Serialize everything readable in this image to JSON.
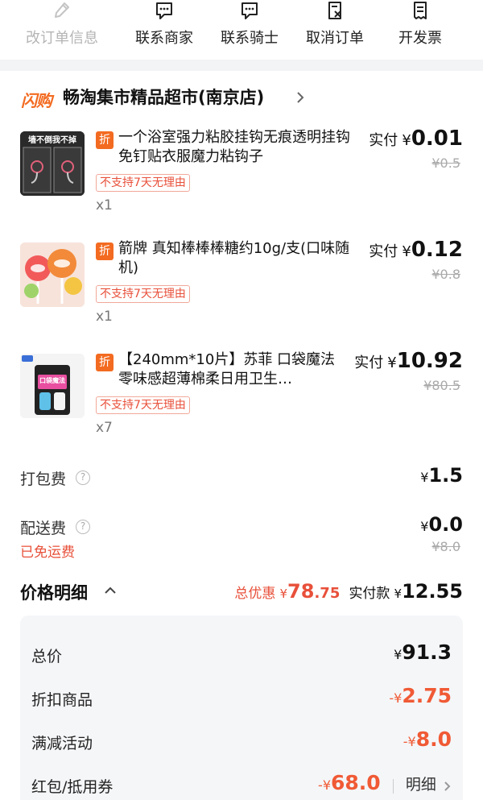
{
  "actions": [
    {
      "label": "改订单信息",
      "icon": "edit-icon",
      "enabled": false
    },
    {
      "label": "联系商家",
      "icon": "chat-icon",
      "enabled": true
    },
    {
      "label": "联系骑士",
      "icon": "chat-icon",
      "enabled": true
    },
    {
      "label": "取消订单",
      "icon": "cancel-doc-icon",
      "enabled": true
    },
    {
      "label": "开发票",
      "icon": "invoice-icon",
      "enabled": true
    }
  ],
  "store": {
    "badge": "闪购",
    "name": "畅淘集市精品超市(南京店)"
  },
  "products": [
    {
      "thumb_text": "墙不倒我不掉",
      "tag": "折",
      "title": "一个浴室强力粘胶挂钩无痕透明挂钩免钉贴衣服魔力粘钩子",
      "policy": "不支持7天无理由",
      "qty": "x1",
      "paid_label": "实付",
      "currency": "¥",
      "paid": "0.01",
      "original": "¥0.5"
    },
    {
      "thumb_text": "",
      "tag": "折",
      "title": "箭牌 真知棒棒棒糖约10g/支(口味随机)",
      "policy": "不支持7天无理由",
      "qty": "x1",
      "paid_label": "实付",
      "currency": "¥",
      "paid": "0.12",
      "original": "¥0.8"
    },
    {
      "thumb_text": "口袋魔法",
      "tag": "折",
      "title": "【240mm*10片】苏菲 口袋魔法零味感超薄棉柔日用卫生…",
      "policy": "不支持7天无理由",
      "qty": "x7",
      "paid_label": "实付",
      "currency": "¥",
      "paid": "10.92",
      "original": "¥80.5"
    }
  ],
  "fees": {
    "packing": {
      "label": "打包费",
      "currency": "¥",
      "value": "1.5"
    },
    "delivery": {
      "label": "配送费",
      "currency": "¥",
      "value": "0.0",
      "original": "¥8.0",
      "note": "已免运费"
    }
  },
  "price_detail": {
    "title": "价格明细",
    "discount_label": "总优惠",
    "currency": "¥",
    "discount_int": "78",
    "discount_dec": ".75",
    "pay_label": "实付款",
    "pay_amount": "12.55",
    "rows": [
      {
        "label": "总价",
        "sign": "",
        "currency": "¥",
        "value": "91.3"
      },
      {
        "label": "折扣商品",
        "sign": "-",
        "currency": "¥",
        "value": "2.75"
      },
      {
        "label": "满减活动",
        "sign": "-",
        "currency": "¥",
        "value": "8.0"
      },
      {
        "label": "红包/抵用券",
        "sign": "-",
        "currency": "¥",
        "value": "68.0",
        "detail": "明细"
      }
    ]
  },
  "colors": {
    "accent_orange": "#f36b21",
    "discount_red": "#f05a35",
    "flash_blue": "#2b7de9"
  }
}
